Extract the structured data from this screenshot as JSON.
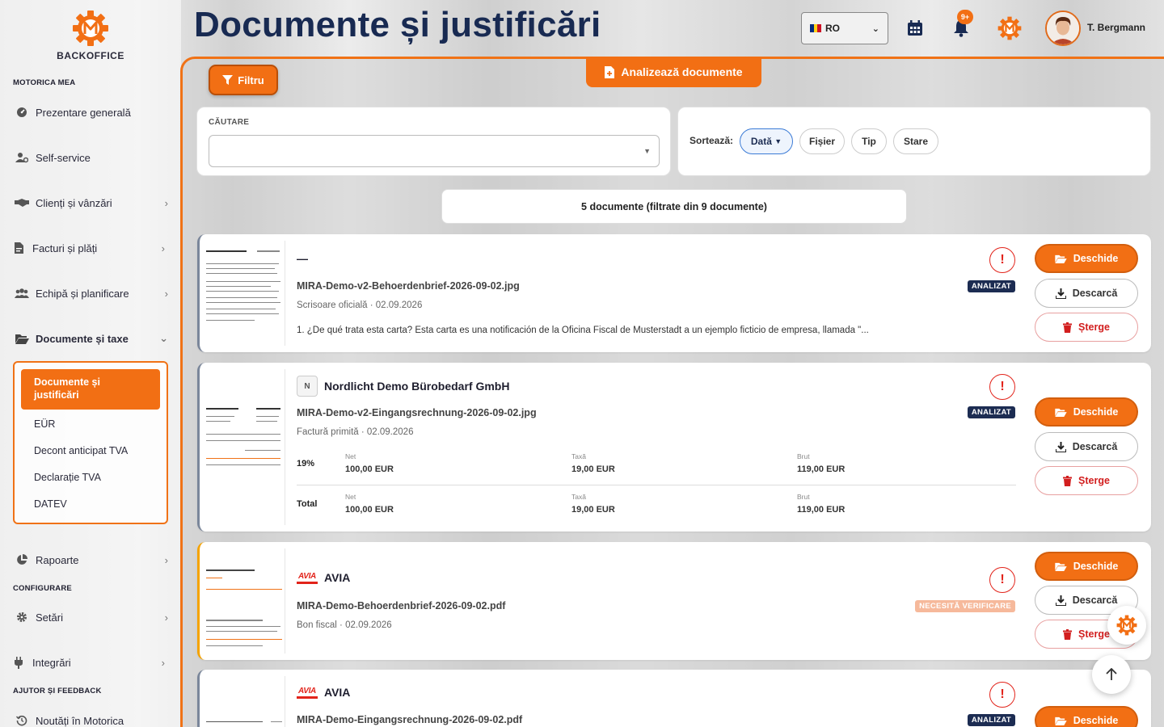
{
  "sidebar": {
    "logo_text": "BACKOFFICE",
    "section_motorica": "MOTORICA MEA",
    "section_config": "CONFIGURARE",
    "section_help": "AJUTOR ȘI FEEDBACK",
    "items": [
      {
        "label": "Prezentare generală"
      },
      {
        "label": "Self-service"
      },
      {
        "label": "Clienți și vânzări"
      },
      {
        "label": "Facturi și plăți"
      },
      {
        "label": "Echipă și planificare"
      },
      {
        "label": "Documente și taxe"
      },
      {
        "label": "Rapoarte"
      },
      {
        "label": "Setări"
      },
      {
        "label": "Integrări"
      },
      {
        "label": "Noutăți în Motorica"
      }
    ],
    "submenu": {
      "active": "Documente și justificări",
      "items": [
        "EÜR",
        "Decont anticipat TVA",
        "Declarație TVA",
        "DATEV"
      ]
    }
  },
  "header": {
    "title": "Documente și justificări",
    "lang": "RO",
    "notif_badge": "9+",
    "user_name": "T. Bergmann"
  },
  "toolbar": {
    "filter_label": "Filtru",
    "analyze_label": "Analizează documente",
    "search_label": "CĂUTARE",
    "search_value": "",
    "sort_label": "Sortează:",
    "sort_options": [
      "Dată",
      "Fișier",
      "Tip",
      "Stare"
    ],
    "count_text": "5 documente (filtrate din 9 documente)"
  },
  "buttons": {
    "open": "Deschide",
    "download": "Descarcă",
    "delete": "Șterge"
  },
  "documents": [
    {
      "title": "—",
      "file": "MIRA-Demo-v2-Behoerdenbrief-2026-09-02.jpg",
      "meta": "Scrisoare oficială · 02.09.2026",
      "description": "1. ¿De qué trata esta carta? Esta carta es una notificación de la Oficina Fiscal de Musterstadt a un ejemplo ficticio de empresa, llamada \"...",
      "status": "ANALIZAT"
    },
    {
      "initial": "N",
      "title": "Nordlicht Demo Bürobedarf GmbH",
      "file": "MIRA-Demo-v2-Eingangsrechnung-2026-09-02.jpg",
      "meta": "Factură primită · 02.09.2026",
      "status": "ANALIZAT",
      "vat": [
        {
          "label": "19%",
          "net_h": "Net",
          "net": "100,00 EUR",
          "tax_h": "Taxă",
          "tax": "19,00 EUR",
          "gross_h": "Brut",
          "gross": "119,00 EUR"
        },
        {
          "label": "Total",
          "net_h": "Net",
          "net": "100,00 EUR",
          "tax_h": "Taxă",
          "tax": "19,00 EUR",
          "gross_h": "Brut",
          "gross": "119,00 EUR"
        }
      ]
    },
    {
      "logo": "AVIA",
      "title": "AVIA",
      "file": "MIRA-Demo-Behoerdenbrief-2026-09-02.pdf",
      "meta": "Bon fiscal · 02.09.2026",
      "status": "NECESITĂ VERIFICARE"
    },
    {
      "logo": "AVIA",
      "title": "AVIA",
      "file": "MIRA-Demo-Eingangsrechnung-2026-09-02.pdf",
      "status": "ANALIZAT"
    }
  ],
  "colors": {
    "accent": "#f26f14",
    "navy": "#182a52",
    "danger": "#e2231a"
  }
}
